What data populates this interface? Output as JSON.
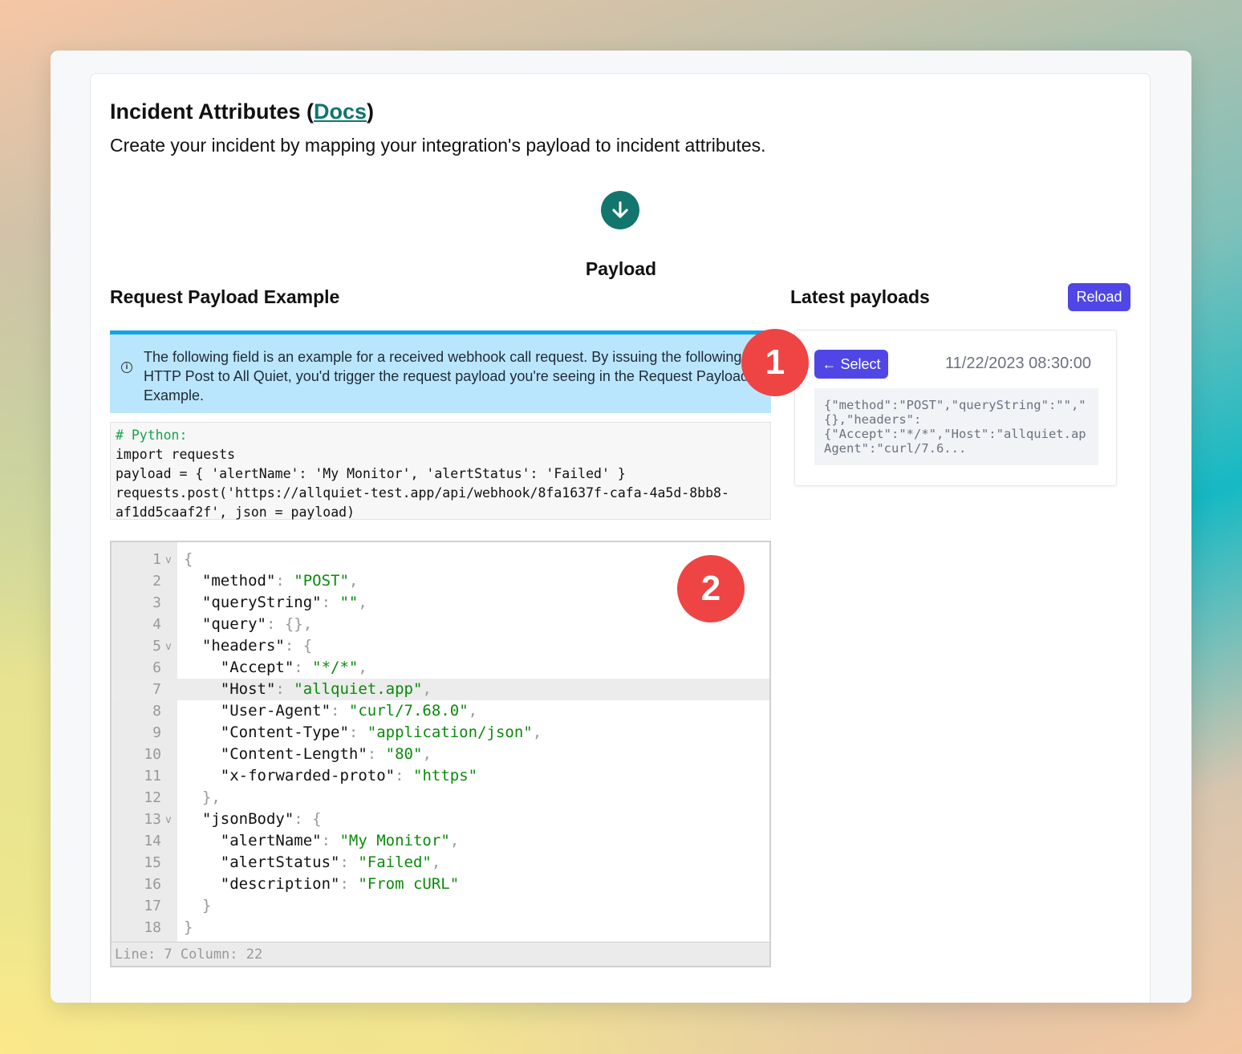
{
  "header": {
    "title": "Incident Attributes (",
    "docs_link": "Docs",
    "title_end": ")",
    "subtitle": "Create your incident by mapping your integration's payload to incident attributes."
  },
  "payload_heading": "Payload",
  "request": {
    "heading": "Request Payload Example",
    "info_text": "The following field is an example for a received webhook call request. By issuing the following HTTP Post to All Quiet, you'd trigger the request payload you're seeing in the Request Payload Example.",
    "code_comment": "# Python:",
    "code_lines": [
      "import requests",
      "payload = { 'alertName': 'My Monitor', 'alertStatus': 'Failed' }",
      "requests.post('https://allquiet-test.app/api/webhook/8fa1637f-cafa-4a5d-8bb8-",
      "af1dd5caaf2f', json = payload)"
    ]
  },
  "editor": {
    "status": "Line: 7  Column: 22"
  },
  "latest": {
    "heading": "Latest payloads",
    "reload_label": "Reload",
    "select_label": "← Select",
    "timestamp": "11/22/2023 08:30:00",
    "preview": "{\"method\":\"POST\",\"queryString\":\"\",\"\n{},\"headers\":\n{\"Accept\":\"*/*\",\"Host\":\"allquiet.ap\nAgent\":\"curl/7.6..."
  },
  "badges": {
    "one": "1",
    "two": "2"
  },
  "colors": {
    "accent": "#4f46e5",
    "teal": "#13766e",
    "badge": "#ef4444",
    "info_bg": "#bae6fd"
  }
}
